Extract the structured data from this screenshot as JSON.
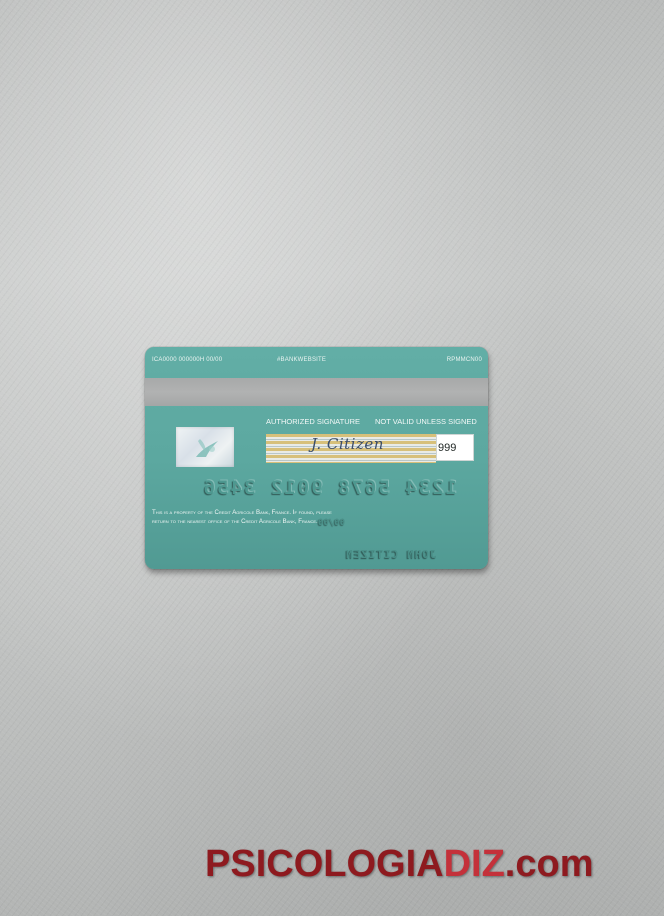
{
  "card": {
    "top_codes": {
      "left": "ICA0000 000000H 00/00",
      "middle": "#BANKWEBSITE",
      "right": "RPMMCN00"
    },
    "authorized_signature_label": "AUTHORIZED SIGNATURE",
    "not_valid_label": "NOT VALID UNLESS SIGNED",
    "signature": "J. Citizen",
    "cvv": "999",
    "card_number": "1234 5678 9012 3456",
    "property_notice_line1": "This is a property of the Credit Agricole Bank, France. If found, please",
    "property_notice_line2": "return to the nearest office of the Credit Agricole Bank, France.",
    "expiry": "00/00",
    "cardholder_name": "JOHN CITIZEN",
    "colors": {
      "card_teal": "#5ca8a0",
      "magnetic_stripe": "#a9abab",
      "signature_stripe": "#d7c07a"
    }
  },
  "watermark": {
    "part1": "PSICOLOGIA",
    "part2": "DIZ",
    "part3": ".com",
    "color": "#a31d22"
  }
}
